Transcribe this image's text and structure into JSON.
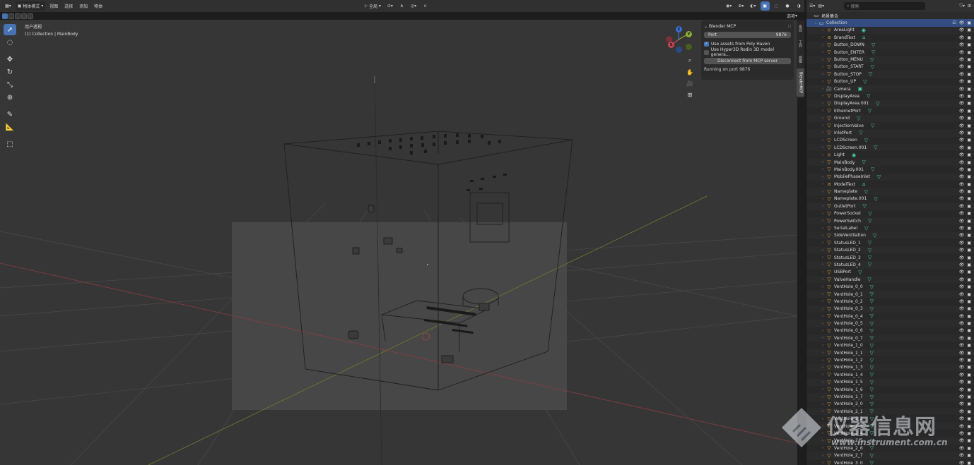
{
  "header": {
    "mode": "物体模式",
    "menus": [
      "视图",
      "选择",
      "添加",
      "物体"
    ],
    "global": "全局",
    "options": "选项"
  },
  "viewport": {
    "view_name": "用户透视",
    "collection_path": "(1) Collection | MainBody"
  },
  "gizmo": {
    "z": "Z",
    "y": "Y",
    "x": "X"
  },
  "npanel": {
    "title": "Blender MCP",
    "port_label": "Port",
    "port_value": "9876",
    "opt_polyhaven": "Use assets from Poly Haven",
    "opt_hyper3d": "Use Hyper3D Rodin 3D model genera...",
    "disconnect_button": "Disconnect from MCP server",
    "status": "Running on port 9876"
  },
  "vtabs": [
    "条目",
    "工具",
    "视图",
    "BlenderMCP"
  ],
  "outliner": {
    "search_placeholder": "搜索",
    "scene": "场景集合",
    "collection": "Collection",
    "items": [
      {
        "name": "AreaLight",
        "type": "light"
      },
      {
        "name": "BrandText",
        "type": "text"
      },
      {
        "name": "Button_DOWN",
        "type": "mesh"
      },
      {
        "name": "Button_ENTER",
        "type": "mesh"
      },
      {
        "name": "Button_MENU",
        "type": "mesh"
      },
      {
        "name": "Button_START",
        "type": "mesh"
      },
      {
        "name": "Button_STOP",
        "type": "mesh"
      },
      {
        "name": "Button_UP",
        "type": "mesh"
      },
      {
        "name": "Camera",
        "type": "camera"
      },
      {
        "name": "DisplayArea",
        "type": "mesh"
      },
      {
        "name": "DisplayArea.001",
        "type": "mesh"
      },
      {
        "name": "EthernetPort",
        "type": "mesh"
      },
      {
        "name": "Ground",
        "type": "mesh"
      },
      {
        "name": "InjectionValve",
        "type": "mesh"
      },
      {
        "name": "InletPort",
        "type": "mesh"
      },
      {
        "name": "LCDScreen",
        "type": "mesh"
      },
      {
        "name": "LCDScreen.001",
        "type": "mesh"
      },
      {
        "name": "Light",
        "type": "light"
      },
      {
        "name": "MainBody",
        "type": "mesh"
      },
      {
        "name": "MainBody.001",
        "type": "mesh"
      },
      {
        "name": "MobilePhaseInlet",
        "type": "mesh"
      },
      {
        "name": "ModelText",
        "type": "text"
      },
      {
        "name": "Nameplate",
        "type": "mesh"
      },
      {
        "name": "Nameplate.001",
        "type": "mesh"
      },
      {
        "name": "OutletPort",
        "type": "mesh"
      },
      {
        "name": "PowerSocket",
        "type": "mesh"
      },
      {
        "name": "PowerSwitch",
        "type": "mesh"
      },
      {
        "name": "SerialLabel",
        "type": "mesh"
      },
      {
        "name": "SideVentilation",
        "type": "mesh"
      },
      {
        "name": "StatusLED_1",
        "type": "mesh"
      },
      {
        "name": "StatusLED_2",
        "type": "mesh"
      },
      {
        "name": "StatusLED_3",
        "type": "mesh"
      },
      {
        "name": "StatusLED_4",
        "type": "mesh"
      },
      {
        "name": "USBPort",
        "type": "mesh"
      },
      {
        "name": "ValveHandle",
        "type": "mesh"
      },
      {
        "name": "VentHole_0_0",
        "type": "mesh"
      },
      {
        "name": "VentHole_0_1",
        "type": "mesh"
      },
      {
        "name": "VentHole_0_2",
        "type": "mesh"
      },
      {
        "name": "VentHole_0_3",
        "type": "mesh"
      },
      {
        "name": "VentHole_0_4",
        "type": "mesh"
      },
      {
        "name": "VentHole_0_5",
        "type": "mesh"
      },
      {
        "name": "VentHole_0_6",
        "type": "mesh"
      },
      {
        "name": "VentHole_0_7",
        "type": "mesh"
      },
      {
        "name": "VentHole_1_0",
        "type": "mesh"
      },
      {
        "name": "VentHole_1_1",
        "type": "mesh"
      },
      {
        "name": "VentHole_1_2",
        "type": "mesh"
      },
      {
        "name": "VentHole_1_3",
        "type": "mesh"
      },
      {
        "name": "VentHole_1_4",
        "type": "mesh"
      },
      {
        "name": "VentHole_1_5",
        "type": "mesh"
      },
      {
        "name": "VentHole_1_6",
        "type": "mesh"
      },
      {
        "name": "VentHole_1_7",
        "type": "mesh"
      },
      {
        "name": "VentHole_2_0",
        "type": "mesh"
      },
      {
        "name": "VentHole_2_1",
        "type": "mesh"
      },
      {
        "name": "VentHole_2_2",
        "type": "mesh"
      },
      {
        "name": "VentHole_2_3",
        "type": "mesh"
      },
      {
        "name": "VentHole_2_4",
        "type": "mesh"
      },
      {
        "name": "VentHole_2_5",
        "type": "mesh"
      },
      {
        "name": "VentHole_2_6",
        "type": "mesh"
      },
      {
        "name": "VentHole_2_7",
        "type": "mesh"
      },
      {
        "name": "VentHole_3_0",
        "type": "mesh"
      }
    ]
  },
  "watermark": {
    "text": "仪器信息网",
    "url": "www.instrument.com.cn"
  },
  "colors": {
    "accent": "#4772b3",
    "mesh_icon": "#e8a33d",
    "modifier": "#4bd4a4",
    "x_axis": "#c74655",
    "y_axis": "#8aac34"
  }
}
